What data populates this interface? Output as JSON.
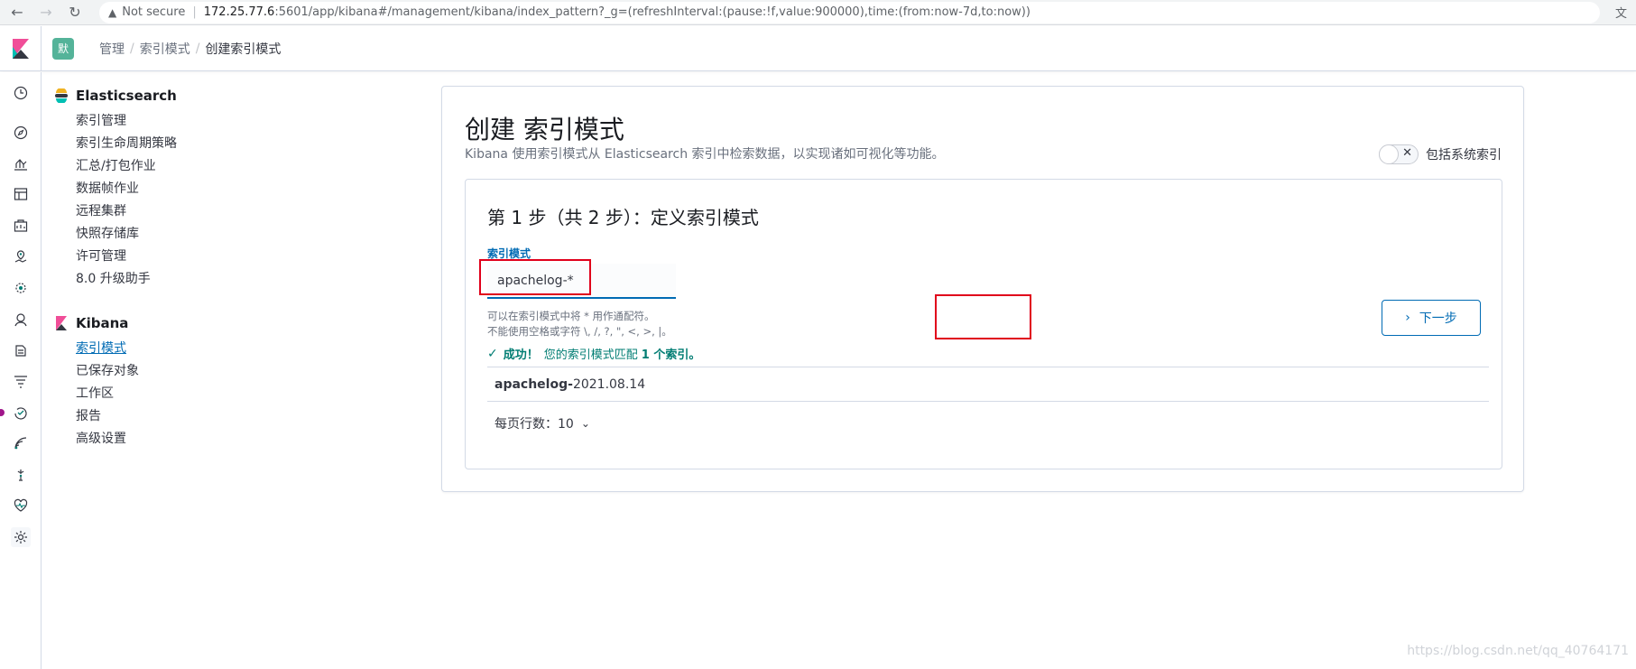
{
  "browser": {
    "not_secure": "Not secure",
    "url_host": "172.25.77.6",
    "url_path": ":5601/app/kibana#/management/kibana/index_pattern?_g=(refreshInterval:(pause:!f,value:900000),time:(from:now-7d,to:now))"
  },
  "header": {
    "space_badge": "默",
    "breadcrumbs": [
      "管理",
      "索引模式",
      "创建索引模式"
    ],
    "separator": "/"
  },
  "side_menu": {
    "elasticsearch": {
      "title": "Elasticsearch",
      "items": [
        "索引管理",
        "索引生命周期策略",
        "汇总/打包作业",
        "数据帧作业",
        "远程集群",
        "快照存储库",
        "许可管理",
        "8.0 升级助手"
      ]
    },
    "kibana": {
      "title": "Kibana",
      "items": [
        "索引模式",
        "已保存对象",
        "工作区",
        "报告",
        "高级设置"
      ],
      "active_index": 0
    }
  },
  "main": {
    "title": "创建 索引模式",
    "description": "Kibana 使用索引模式从 Elasticsearch 索引中检索数据，以实现诸如可视化等功能。",
    "toggle_label": "包括系统索引",
    "step_title": "第 1 步（共 2 步）：定义索引模式",
    "field_label": "索引模式",
    "input_value": "apachelog-*",
    "help_line1": "可以在索引模式中将 * 用作通配符。",
    "help_line2": "不能使用空格或字符 \\, /, ?, \", <, >, |。",
    "success_prefix": "成功！",
    "success_text": "您的索引模式匹配",
    "success_count": "1 个索引。",
    "index_match_bold": "apachelog-",
    "index_match_rest": "2021.08.14",
    "rows_per_page": "每页行数：10",
    "next_button": "下一步"
  },
  "watermark": "https://blog.csdn.net/qq_40764171",
  "colors": {
    "primary": "#006bb4",
    "success": "#017d73",
    "highlight": "#e0001b",
    "space_badge": "#54b399"
  }
}
